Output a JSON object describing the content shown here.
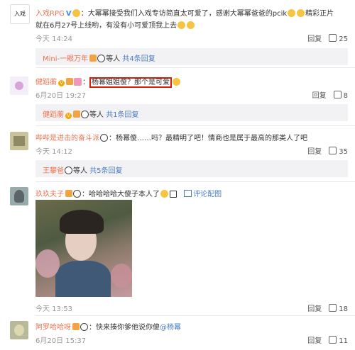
{
  "comments": [
    {
      "user": "入戏RPG",
      "text_line1": "：大幂幂接受我们入戏专访简直太可爱了，感谢大幂幂爸爸的pcik",
      "text_line1_tail": "精彩正片",
      "text_line2": "就在6月27号上线哟，有没有小可爱顶我上去",
      "time": "今天 14:24",
      "reply_label": "回复",
      "likes": "25",
      "avatar_text": "入戏"
    },
    {
      "user": "健蹈蘅",
      "text": "：",
      "highlight_text": "杨幂姐姐傻？那个是可爱",
      "time": "6月20日 19:27",
      "reply_label": "回复",
      "likes": "8"
    },
    {
      "user": "哔哔是进击的奋斗派",
      "text": "：杨幂傻……吗？最精明了吧！情商也是属于最高的那类人了吧",
      "time": "今天 14:12",
      "reply_label": "回复",
      "likes": "35"
    },
    {
      "user": "玖玖夫子",
      "text": "：哈哈哈哈大傻子本人了",
      "pic_comment": "评论配图",
      "time": "今天 13:53",
      "reply_label": "回复",
      "likes": "18"
    },
    {
      "user": "阿罗哈哈呀",
      "text": "：快来揍你爹他说你傻",
      "mention": "@杨幂",
      "time": "6月20日 15:37",
      "reply_label": "回复",
      "likes": "11"
    }
  ],
  "sub_replies": [
    {
      "user": "Mini-一眼万年",
      "suffix": "等人",
      "count": "共4条回复"
    },
    {
      "user": "健蹈蘅",
      "suffix": "等人",
      "count": "共1条回复"
    },
    {
      "user": "王攀爸",
      "suffix": "等人",
      "count": "共5条回复"
    }
  ],
  "colors": {
    "username": "#eb7350",
    "link": "#4a7cc1",
    "highlight_border": "#d81e06"
  }
}
